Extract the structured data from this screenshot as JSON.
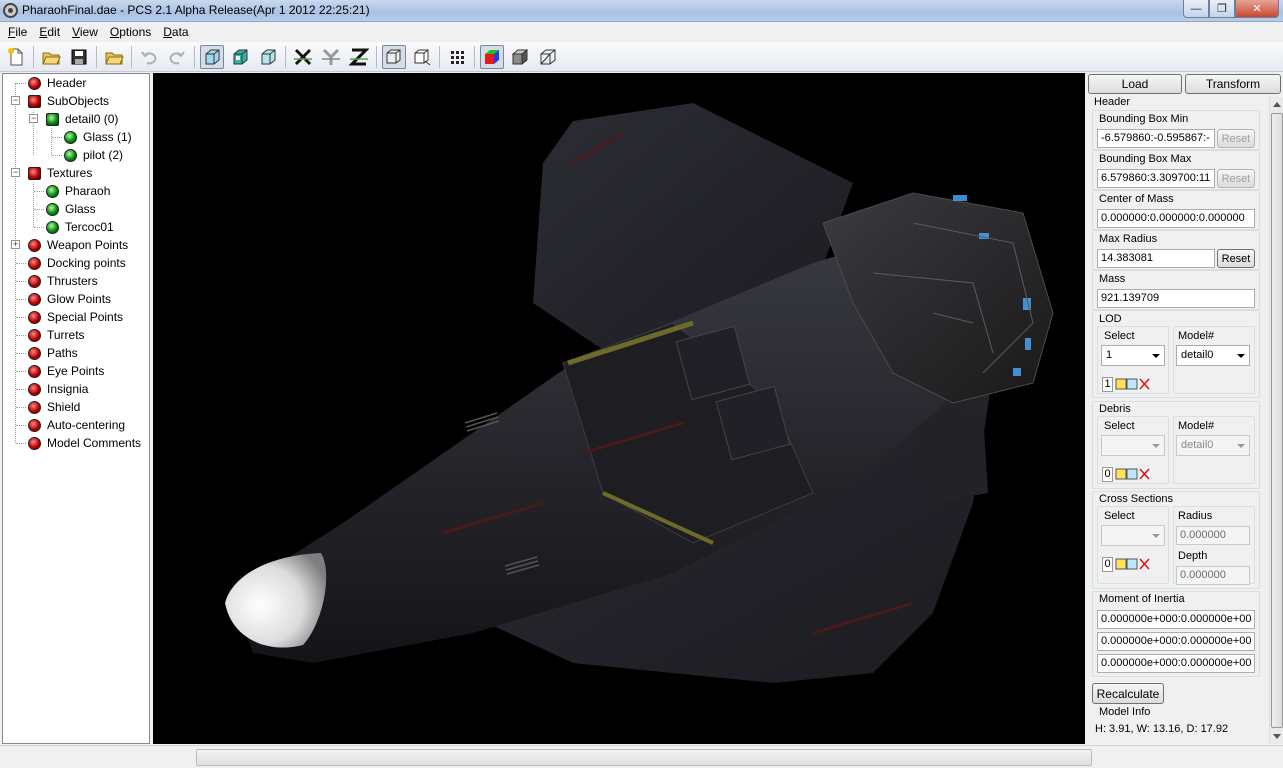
{
  "window": {
    "title": "PharaohFinal.dae - PCS 2.1 Alpha Release(Apr  1 2012 22:25:21)",
    "min_glyph": "—",
    "max_glyph": "❐",
    "close_glyph": "✕"
  },
  "menu": {
    "items": [
      {
        "label_u": "F",
        "label_rest": "ile"
      },
      {
        "label_u": "E",
        "label_rest": "dit"
      },
      {
        "label_u": "V",
        "label_rest": "iew"
      },
      {
        "label_u": "O",
        "label_rest": "ptions"
      },
      {
        "label_u": "D",
        "label_rest": "ata"
      }
    ]
  },
  "toolbar": {
    "icons": [
      "new-file-icon",
      "open-folder-icon",
      "save-icon",
      "open-icon",
      "undo-icon",
      "redo-icon",
      "solid-view-icon",
      "textured-view-icon",
      "wireframe-view-icon",
      "axis-x-icon",
      "axis-y-icon",
      "axis-z-icon",
      "camera-reset-icon",
      "camera-fit-icon",
      "grid-icon",
      "color-cube-icon",
      "gray-cube-icon",
      "wire-cube-icon"
    ]
  },
  "tree": {
    "items": [
      {
        "label": "Header",
        "color": "red"
      },
      {
        "label": "SubObjects",
        "color": "red"
      },
      {
        "label": "detail0 (0)",
        "color": "green"
      },
      {
        "label": "Glass (1)",
        "color": "green"
      },
      {
        "label": "pilot (2)",
        "color": "green"
      },
      {
        "label": "Textures",
        "color": "red"
      },
      {
        "label": "Pharaoh",
        "color": "green"
      },
      {
        "label": "Glass",
        "color": "green"
      },
      {
        "label": "Tercoc01",
        "color": "green"
      },
      {
        "label": "Weapon Points",
        "color": "red"
      },
      {
        "label": "Docking points",
        "color": "red"
      },
      {
        "label": "Thrusters",
        "color": "red"
      },
      {
        "label": "Glow Points",
        "color": "red"
      },
      {
        "label": "Special Points",
        "color": "red"
      },
      {
        "label": "Turrets",
        "color": "red"
      },
      {
        "label": "Paths",
        "color": "red"
      },
      {
        "label": "Eye Points",
        "color": "red"
      },
      {
        "label": "Insignia",
        "color": "red"
      },
      {
        "label": "Shield",
        "color": "red"
      },
      {
        "label": "Auto-centering",
        "color": "red"
      },
      {
        "label": "Model Comments",
        "color": "red"
      }
    ]
  },
  "panel": {
    "load_label": "Load",
    "transform_label": "Transform",
    "section_title": "Header",
    "bbox_min_label": "Bounding Box Min",
    "bbox_min_value": "-6.579860:-0.595867:-",
    "bbox_max_label": "Bounding Box Max",
    "bbox_max_value": "6.579860:3.309700:11",
    "reset_label": "Reset",
    "com_label": "Center of Mass",
    "com_value": "0.000000:0.000000:0.000000",
    "max_radius_label": "Max Radius",
    "max_radius_value": "14.383081",
    "mass_label": "Mass",
    "mass_value": "921.139709",
    "lod_label": "LOD",
    "select_label": "Select",
    "model_label": "Model#",
    "lod_select_value": "1",
    "lod_model_value": "detail0",
    "lod_count": "1",
    "debris_label": "Debris",
    "debris_select_value": "",
    "debris_model_value": "detail0",
    "debris_count": "0",
    "cross_label": "Cross Sections",
    "radius_label": "Radius",
    "radius_value": "0.000000",
    "depth_label": "Depth",
    "depth_value": "0.000000",
    "cross_count": "0",
    "moi_label": "Moment of Inertia",
    "moi_row1": "0.000000e+000:0.000000e+00",
    "moi_row2": "0.000000e+000:0.000000e+00",
    "moi_row3": "0.000000e+000:0.000000e+00",
    "recalc_label": "Recalculate",
    "model_info_label": "Model Info",
    "model_info_value": "H: 3.91, W: 13.16, D: 17.92"
  }
}
